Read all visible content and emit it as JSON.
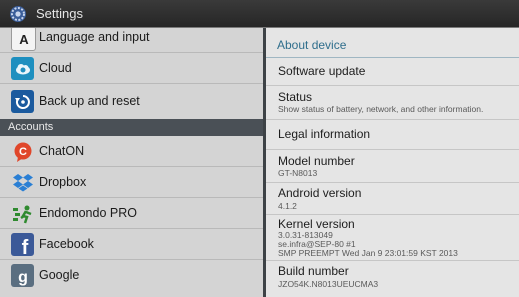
{
  "titlebar": {
    "title": "Settings",
    "icon": "settings-gear-icon"
  },
  "sidebar": {
    "items_top": [
      {
        "label": "Language and input",
        "icon": "language-keyboard-icon"
      },
      {
        "label": "Cloud",
        "icon": "cloud-icon"
      },
      {
        "label": "Back up and reset",
        "icon": "backup-reset-icon"
      }
    ],
    "accounts_header": "Accounts",
    "accounts": [
      {
        "label": "ChatON",
        "icon": "chaton-icon"
      },
      {
        "label": "Dropbox",
        "icon": "dropbox-icon"
      },
      {
        "label": "Endomondo PRO",
        "icon": "endomondo-icon"
      },
      {
        "label": "Facebook",
        "icon": "facebook-icon"
      },
      {
        "label": "Google",
        "icon": "google-icon"
      }
    ]
  },
  "about": {
    "title": "About device",
    "software_update": "Software update",
    "status": {
      "title": "Status",
      "subtitle": "Show status of battery, network, and other information."
    },
    "legal": "Legal information",
    "model": {
      "title": "Model number",
      "value": "GT-N8013"
    },
    "android": {
      "title": "Android version",
      "value": "4.1.2"
    },
    "kernel": {
      "title": "Kernel version",
      "line1": "3.0.31-813049",
      "line2": "se.infra@SEP-80 #1",
      "line3": "SMP PREEMPT Wed Jan 9 23:01:59 KST 2013"
    },
    "build": {
      "title": "Build number",
      "value": "JZO54K.N8013UEUCMA3"
    }
  },
  "colors": {
    "accent": "#2f6e8c",
    "titlebar": "#2e2e2e",
    "accounts_header": "#4a5056",
    "left_bg": "#d4d4d4",
    "right_bg": "#e5e5e5"
  }
}
